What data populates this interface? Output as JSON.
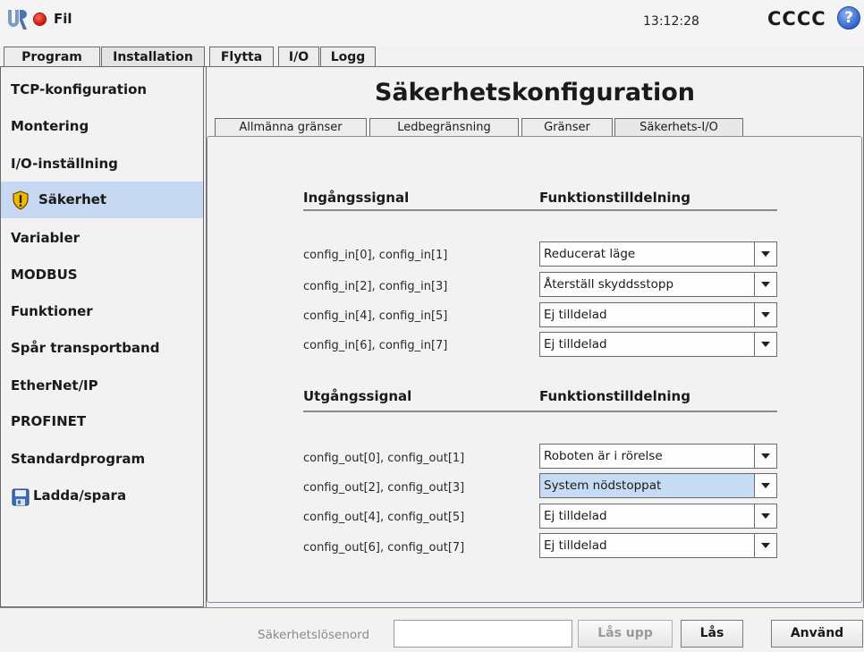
{
  "header": {
    "file_menu": "Fil",
    "clock": "13:12:28",
    "robot_name": "CCCC",
    "help_glyph": "?"
  },
  "main_tabs": [
    "Program",
    "Installation",
    "Flytta",
    "I/O",
    "Logg"
  ],
  "active_main_tab": "Installation",
  "sidebar": {
    "items": [
      {
        "label": "TCP-konfiguration"
      },
      {
        "label": "Montering"
      },
      {
        "label": "I/O-inställning"
      },
      {
        "label": "Säkerhet",
        "icon": "warning-shield-icon",
        "selected": true
      },
      {
        "label": "Variabler"
      },
      {
        "label": "MODBUS"
      },
      {
        "label": "Funktioner"
      },
      {
        "label": "Spår transportband"
      },
      {
        "label": "EtherNet/IP"
      },
      {
        "label": "PROFINET"
      },
      {
        "label": "Standardprogram"
      },
      {
        "label": "Ladda/spara",
        "icon": "floppy-disk-icon"
      }
    ]
  },
  "page_title": "Säkerhetskonfiguration",
  "sub_tabs": [
    "Allmänna gränser",
    "Ledbegränsning",
    "Gränser",
    "Säkerhets-I/O"
  ],
  "active_sub_tab": "Säkerhets-I/O",
  "inputs": {
    "header_signal": "Ingångssignal",
    "header_function": "Funktionstilldelning",
    "rows": [
      {
        "signal": "config_in[0], config_in[1]",
        "value": "Reducerat läge"
      },
      {
        "signal": "config_in[2], config_in[3]",
        "value": "Återställ skyddsstopp"
      },
      {
        "signal": "config_in[4], config_in[5]",
        "value": "Ej tilldelad"
      },
      {
        "signal": "config_in[6], config_in[7]",
        "value": "Ej tilldelad"
      }
    ]
  },
  "outputs": {
    "header_signal": "Utgångssignal",
    "header_function": "Funktionstilldelning",
    "rows": [
      {
        "signal": "config_out[0], config_out[1]",
        "value": "Roboten är i rörelse"
      },
      {
        "signal": "config_out[2], config_out[3]",
        "value": "System nödstoppat",
        "highlighted": true
      },
      {
        "signal": "config_out[4], config_out[5]",
        "value": "Ej tilldelad"
      },
      {
        "signal": "config_out[6], config_out[7]",
        "value": "Ej tilldelad"
      }
    ]
  },
  "footer": {
    "password_label": "Säkerhetslösenord",
    "password_value": "",
    "unlock_label": "Lås upp",
    "lock_label": "Lås",
    "apply_label": "Använd"
  },
  "colors": {
    "selection": "#c6d8f2",
    "dropdown_highlight": "#c6dcf4",
    "warning_icon": "#f2b800",
    "status_dot": "#d4140b"
  }
}
